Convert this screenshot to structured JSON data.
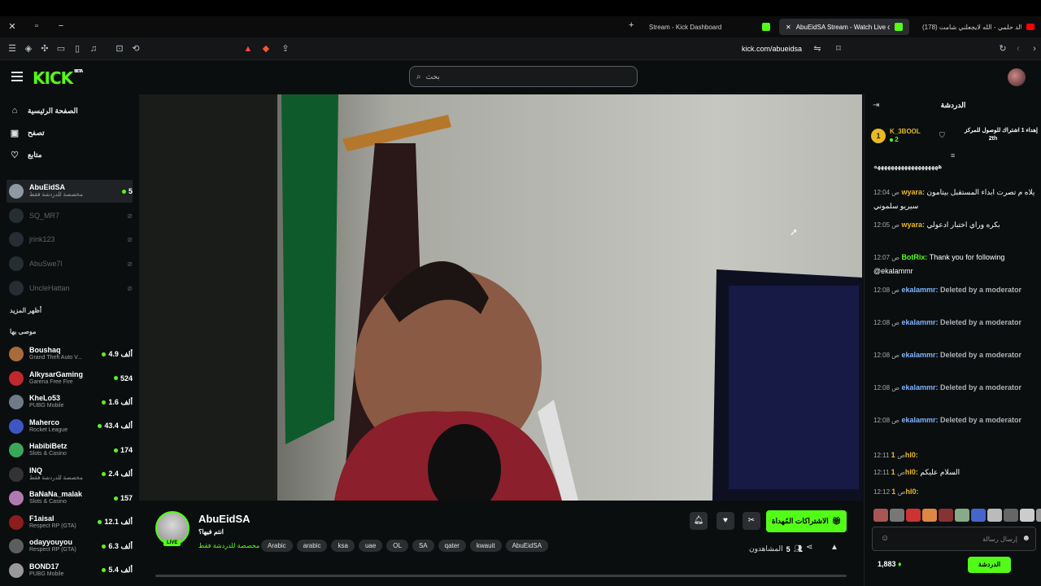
{
  "browser": {
    "tabs": [
      {
        "title": "Stream - Kick Dashboard"
      },
      {
        "title": "AbuEidSA Stream - Watch Live o"
      },
      {
        "title": "(178) فالد حلمي - الله لايجعلني شامت"
      }
    ],
    "url": "kick.com/abueidsa"
  },
  "header": {
    "logo": "KICK",
    "logo_badge": "BETA",
    "search_placeholder": "بحث"
  },
  "sidebar": {
    "nav": [
      {
        "label": "الصفحة الرئيسية",
        "icon": "home-icon"
      },
      {
        "label": "تصفح",
        "icon": "browse-icon"
      },
      {
        "label": "متابع",
        "icon": "heart-icon"
      }
    ],
    "following": [
      {
        "name": "AbuEidSA",
        "sub": "مخصصة للدردشة فقط",
        "count": "5",
        "live": true
      },
      {
        "name": "SQ_MR7",
        "sub": "",
        "count": "",
        "live": false
      },
      {
        "name": "jrink123",
        "sub": "",
        "count": "",
        "live": false
      },
      {
        "name": "AbuSwe7l",
        "sub": "",
        "count": "",
        "live": false
      },
      {
        "name": "UncleHattan",
        "sub": "",
        "count": "",
        "live": false
      }
    ],
    "show_more": "أظهر المزيد",
    "recommended_label": "موصى بها",
    "recommended": [
      {
        "name": "Boushaq",
        "sub": "Grand Theft Auto V...",
        "count": "4.9 ألف"
      },
      {
        "name": "AlkysarGaming",
        "sub": "Garena Free Fire",
        "count": "524"
      },
      {
        "name": "KheLo53",
        "sub": "PUBG Mobile",
        "count": "1.6 ألف"
      },
      {
        "name": "Maherco",
        "sub": "Rocket League",
        "count": "43.4 ألف"
      },
      {
        "name": "HabibiBetz",
        "sub": "Slots & Casino",
        "count": "174"
      },
      {
        "name": "INQ",
        "sub": "مخصصة للدردشة فقط",
        "count": "2.4 ألف"
      },
      {
        "name": "BaNaNa_malak",
        "sub": "Slots & Casino",
        "count": "157"
      },
      {
        "name": "F1aisal",
        "sub": "Respect RP (GTA)",
        "count": "12.1 ألف"
      },
      {
        "name": "odayyouyou",
        "sub": "Respect RP (GTA)",
        "count": "6.3 ألف"
      },
      {
        "name": "BOND17",
        "sub": "PUBG Mobile",
        "count": "5.4 ألف"
      }
    ]
  },
  "stream": {
    "streamer": "AbuEidSA",
    "live_label": "LIVE",
    "title": "انتم فيها؟",
    "category": "مخصصة للدردشة فقط",
    "tags": [
      "Arabic",
      "arabic",
      "ksa",
      "uae",
      "OL",
      "SA",
      "qater",
      "kwauit",
      "AbuEidSA"
    ],
    "subscribe_label": "الاشتراكات المُهداة",
    "viewers_label": "المشاهدون",
    "viewers": "5"
  },
  "chat": {
    "title": "الدردشة",
    "pinned": {
      "rank": "1",
      "user": "K_3BOOL",
      "count": "2",
      "text": "إهداء 1 اشتراك للوصول للمركز",
      "place": "2th"
    },
    "messages": [
      {
        "time": "",
        "user": "",
        "user_color": "#ffffff",
        "text": "هههههههههههههههههههه"
      },
      {
        "time": "12:04 ص",
        "user": "wyara:",
        "user_color": "#e8b923",
        "text": "يلاه م تصرت ابداء المستقبل بيتامون سيريو سلموني"
      },
      {
        "time": "12:05 ص",
        "user": "wyara:",
        "user_color": "#e8b923",
        "text": "بكره وراي اختبار ادعولي"
      },
      {
        "time": "12:07 ص",
        "user": "BotRix:",
        "user_color": "#53fc18",
        "text": "Thank you for following @ekalammr"
      },
      {
        "time": "12:08 ص",
        "user": "ekalammr:",
        "user_color": "#7db4ff",
        "text": "Deleted by a moderator"
      },
      {
        "time": "12:08 ص",
        "user": "ekalammr:",
        "user_color": "#7db4ff",
        "text": "Deleted by a moderator"
      },
      {
        "time": "12:08 ص",
        "user": "ekalammr:",
        "user_color": "#7db4ff",
        "text": "Deleted by a moderator"
      },
      {
        "time": "12:08 ص",
        "user": "ekalammr:",
        "user_color": "#7db4ff",
        "text": "Deleted by a moderator"
      },
      {
        "time": "12:08 ص",
        "user": "ekalammr:",
        "user_color": "#7db4ff",
        "text": "Deleted by a moderator"
      },
      {
        "time": "12:11 ص",
        "user": "1hl0:",
        "user_color": "#e8b923",
        "text": ""
      },
      {
        "time": "12:11 ص",
        "user": "1hl0:",
        "user_color": "#e8b923",
        "text": "السلام عليكم"
      },
      {
        "time": "12:12 ص",
        "user": "1hl0:",
        "user_color": "#e8b923",
        "text": ""
      }
    ],
    "input_placeholder": "إرسال رسالة",
    "points": "1,883",
    "send_label": "الدردشة"
  },
  "colors": {
    "accent": "#53fc18",
    "background": "#0b0e0f"
  }
}
